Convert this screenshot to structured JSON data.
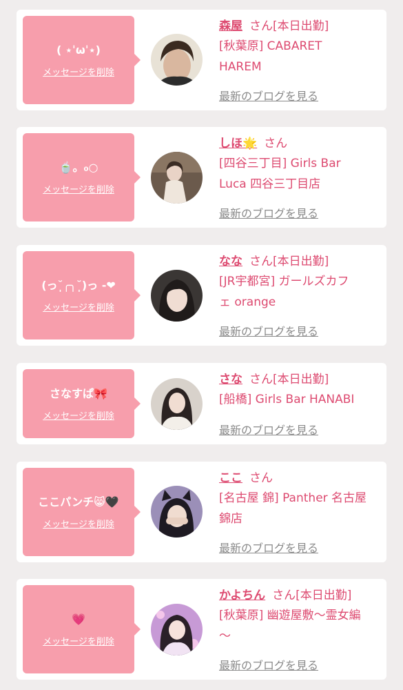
{
  "cards": [
    {
      "message": "( ⋆ˈωˈ⋆)",
      "delete_label": "メッセージを削除",
      "name": "森屋",
      "suffix": "さん",
      "status": "[本日出勤]",
      "store_lines": [
        "[秋葉原] CABARET",
        "HAREM"
      ],
      "blog_label": "最新のブログを見る"
    },
    {
      "message": "🍵。₀○",
      "delete_label": "メッセージを削除",
      "name": "しほ🌟",
      "suffix": "さん",
      "status": "",
      "store_lines": [
        "[四谷三丁目] Girls Bar",
        "Luca 四谷三丁目店"
      ],
      "blog_label": "最新のブログを見る"
    },
    {
      "message": "(っ˘̩╭╮˘̩)っ ‐❤",
      "delete_label": "メッセージを削除",
      "name": "なな",
      "suffix": "さん",
      "status": "[本日出勤]",
      "store_lines": [
        "[JR宇都宮] ガールズカフ",
        "ェ orange"
      ],
      "blog_label": "最新のブログを見る"
    },
    {
      "message": "さなすぱ🎀",
      "delete_label": "メッセージを削除",
      "name": "さな",
      "suffix": "さん",
      "status": "[本日出勤]",
      "store_lines": [
        "[船橋] Girls Bar HANABI"
      ],
      "blog_label": "最新のブログを見る"
    },
    {
      "message": "ここパンチ😸🖤",
      "delete_label": "メッセージを削除",
      "name": "ここ",
      "suffix": "さん",
      "status": "",
      "store_lines": [
        "[名古屋 錦] Panther 名古屋",
        "錦店"
      ],
      "blog_label": "最新のブログを見る"
    },
    {
      "message": "💗",
      "delete_label": "メッセージを削除",
      "name": "かよちん",
      "suffix": "さん",
      "status": "[本日出勤]",
      "store_lines": [
        "[秋葉原] 幽遊屋敷〜霊女編",
        "〜"
      ],
      "blog_label": "最新のブログを見る"
    }
  ]
}
